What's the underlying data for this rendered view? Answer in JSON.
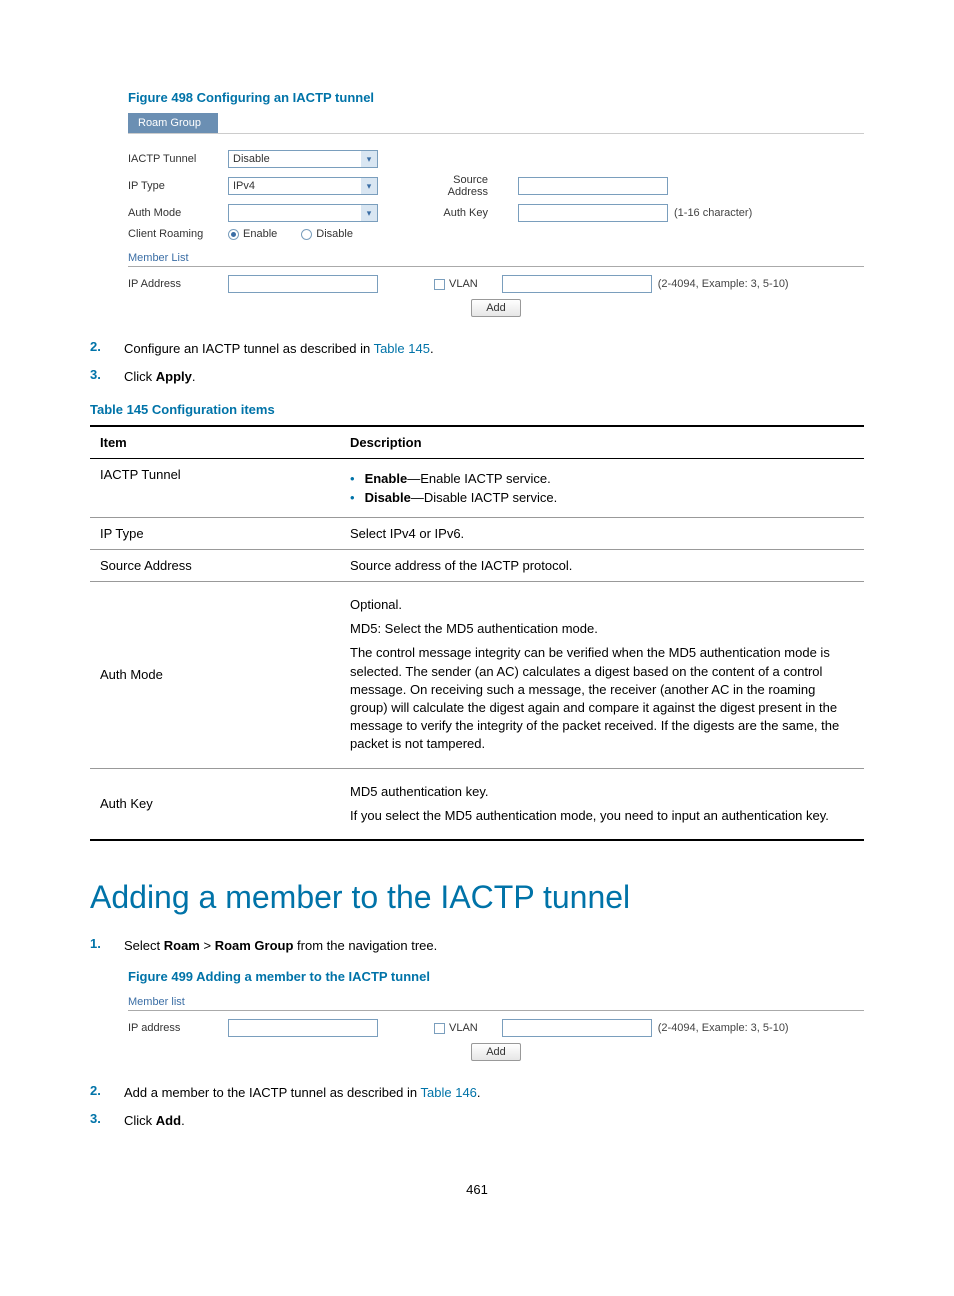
{
  "figure498": {
    "caption": "Figure 498 Configuring an IACTP tunnel",
    "tab": "Roam Group",
    "fields": {
      "iactp_tunnel_label": "IACTP Tunnel",
      "iactp_tunnel_value": "Disable",
      "ip_type_label": "IP Type",
      "ip_type_value": "IPv4",
      "auth_mode_label": "Auth Mode",
      "auth_mode_value": "",
      "client_roaming_label": "Client Roaming",
      "enable_label": "Enable",
      "disable_label": "Disable",
      "source_address_label": "Source Address",
      "auth_key_label": "Auth Key",
      "auth_key_hint": "(1-16 character)",
      "member_list_label": "Member List",
      "ip_address_label": "IP Address",
      "vlan_label": "VLAN",
      "vlan_hint": "(2-4094, Example: 3, 5-10)",
      "add_btn": "Add"
    }
  },
  "steps_section1": {
    "step2_num": "2.",
    "step2_text_pre": "Configure an IACTP tunnel as described in ",
    "step2_link": "Table 145",
    "step2_text_post": ".",
    "step3_num": "3.",
    "step3_text_pre": "Click ",
    "step3_bold": "Apply",
    "step3_text_post": "."
  },
  "table145": {
    "caption": "Table 145 Configuration items",
    "head_item": "Item",
    "head_desc": "Description",
    "rows": {
      "iactp_tunnel": {
        "item": "IACTP Tunnel",
        "b1_strong": "Enable",
        "b1_rest": "—Enable IACTP service.",
        "b2_strong": "Disable",
        "b2_rest": "—Disable IACTP service."
      },
      "ip_type": {
        "item": "IP Type",
        "desc": "Select IPv4 or IPv6."
      },
      "source_address": {
        "item": "Source Address",
        "desc": "Source address of the IACTP protocol."
      },
      "auth_mode": {
        "item": "Auth Mode",
        "p1": "Optional.",
        "p2": "MD5: Select the MD5 authentication mode.",
        "p3": "The control message integrity can be verified when the MD5 authentication mode is selected. The sender (an AC) calculates a digest based on the content of a control message. On receiving such a message, the receiver (another AC in the roaming group) will calculate the digest again and compare it against the digest present in the message to verify the integrity of the packet received. If the digests are the same, the packet is not tampered."
      },
      "auth_key": {
        "item": "Auth Key",
        "p1": "MD5 authentication key.",
        "p2": "If you select the MD5 authentication mode, you need to input an authentication key."
      }
    }
  },
  "heading": "Adding a member to the IACTP tunnel",
  "steps_section2": {
    "step1_num": "1.",
    "step1_pre": "Select ",
    "step1_b1": "Roam",
    "step1_mid": " > ",
    "step1_b2": "Roam Group",
    "step1_post": " from the navigation tree."
  },
  "figure499": {
    "caption": "Figure 499 Adding a member to the IACTP tunnel",
    "member_list_label": "Member list",
    "ip_address_label": "IP address",
    "vlan_label": "VLAN",
    "vlan_hint": "(2-4094, Example: 3, 5-10)",
    "add_btn": "Add"
  },
  "steps_section3": {
    "step2_num": "2.",
    "step2_pre": "Add a member to the IACTP tunnel as described in ",
    "step2_link": "Table 146",
    "step2_post": ".",
    "step3_num": "3.",
    "step3_pre": "Click ",
    "step3_bold": "Add",
    "step3_post": "."
  },
  "page_number": "461"
}
